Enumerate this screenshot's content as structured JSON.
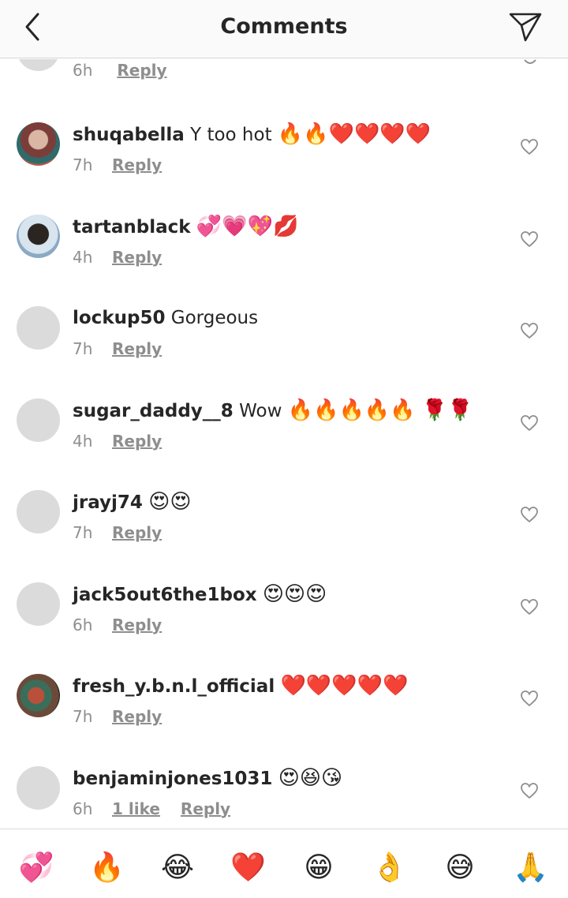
{
  "header": {
    "title": "Comments",
    "back_icon": "chevron-left-icon",
    "send_icon": "paper-plane-icon"
  },
  "colors": {
    "text": "#262626",
    "muted": "#8e8e8e",
    "placeholder_avatar": "#dbdbdb"
  },
  "partial_top": {
    "time": "6h",
    "reply": "Reply"
  },
  "comments": [
    {
      "username": "shuqabella",
      "text": "Y too hot",
      "emoji": "🔥🔥❤️❤️❤️❤️",
      "time": "7h",
      "reply": "Reply",
      "avatar": "photo"
    },
    {
      "username": "tartanblack",
      "text": "",
      "emoji": "💞💗💖💋",
      "time": "4h",
      "reply": "Reply",
      "avatar": "photo"
    },
    {
      "username": "lockup50",
      "text": "Gorgeous",
      "emoji": "",
      "time": "7h",
      "reply": "Reply",
      "avatar": "placeholder"
    },
    {
      "username": "sugar_daddy__8",
      "text": "Wow",
      "emoji": "🔥🔥🔥🔥🔥 🌹🌹",
      "time": "4h",
      "reply": "Reply",
      "avatar": "placeholder"
    },
    {
      "username": "jrayj74",
      "text": "",
      "emoji": "😍😍",
      "time": "7h",
      "reply": "Reply",
      "avatar": "placeholder"
    },
    {
      "username": "jack5out6the1box",
      "text": "",
      "emoji": "😍😍😍",
      "time": "6h",
      "reply": "Reply",
      "avatar": "placeholder"
    },
    {
      "username": "fresh_y.b.n.l_official",
      "text": "",
      "emoji": "❤️❤️❤️❤️❤️",
      "time": "7h",
      "reply": "Reply",
      "avatar": "photo"
    },
    {
      "username": "benjaminjones1031",
      "text": "",
      "emoji": "😍😆😘",
      "time": "6h",
      "likes": "1 like",
      "reply": "Reply",
      "avatar": "placeholder"
    }
  ],
  "reactions": [
    "💞",
    "🔥",
    "😂",
    "❤️",
    "😁",
    "👌",
    "😅",
    "🙏"
  ]
}
